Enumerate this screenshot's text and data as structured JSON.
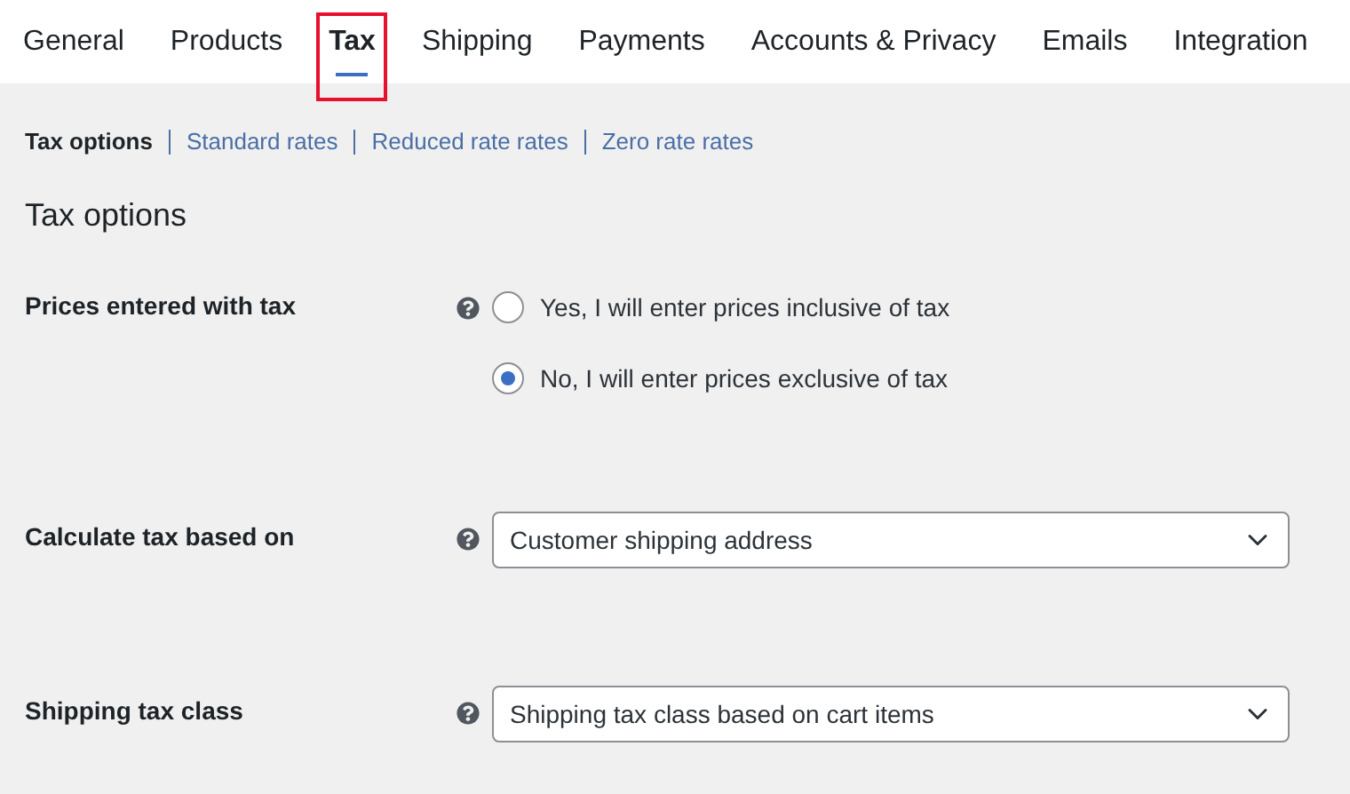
{
  "tabs": [
    {
      "label": "General",
      "selected": false,
      "highlighted": false
    },
    {
      "label": "Products",
      "selected": false,
      "highlighted": false
    },
    {
      "label": "Tax",
      "selected": true,
      "highlighted": true
    },
    {
      "label": "Shipping",
      "selected": false,
      "highlighted": false
    },
    {
      "label": "Payments",
      "selected": false,
      "highlighted": false
    },
    {
      "label": "Accounts & Privacy",
      "selected": false,
      "highlighted": false
    },
    {
      "label": "Emails",
      "selected": false,
      "highlighted": false
    },
    {
      "label": "Integration",
      "selected": false,
      "highlighted": false
    }
  ],
  "sections": [
    {
      "label": "Tax options",
      "selected": true
    },
    {
      "label": "Standard rates",
      "selected": false
    },
    {
      "label": "Reduced rate rates",
      "selected": false
    },
    {
      "label": "Zero rate rates",
      "selected": false
    }
  ],
  "heading": "Tax options",
  "fields": [
    {
      "kind": "radio",
      "label": "Prices entered with tax",
      "options": [
        {
          "label": "Yes, I will enter prices inclusive of tax",
          "selected": false
        },
        {
          "label": "No, I will enter prices exclusive of tax",
          "selected": true
        }
      ]
    },
    {
      "kind": "select",
      "label": "Calculate tax based on",
      "value": "Customer shipping address"
    },
    {
      "kind": "select",
      "label": "Shipping tax class",
      "value": "Shipping tax class based on cart items"
    }
  ]
}
